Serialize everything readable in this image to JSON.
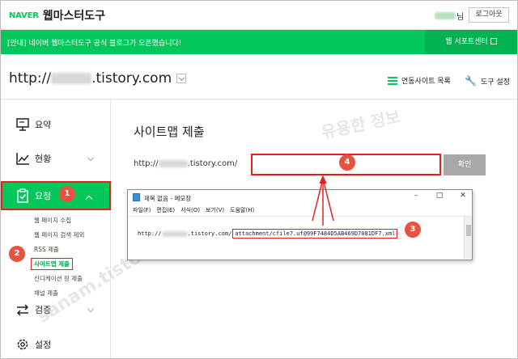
{
  "header": {
    "logo_naver": "NAVER",
    "logo_title": "웹마스터도구",
    "user_suffix": "님",
    "logout_label": "로그아웃"
  },
  "banner": {
    "text": "[안내] 네이버 웹마스터도구 공식 블로그가 오픈했습니다!",
    "support_label": "웹 서포트센터"
  },
  "site": {
    "url_prefix": "http://",
    "url_suffix": ".tistory.com",
    "linked_sites_label": "연동사이트 목록",
    "tool_settings_label": "도구 설정"
  },
  "sidebar": {
    "summary": "요약",
    "status": "현황",
    "request": "요청",
    "sub_items": [
      "웹 페이지 수집",
      "웹 페이지 검색 제외",
      "RSS 제출",
      "사이트맵 제출",
      "신디케이션 핑 제출",
      "채널 제출"
    ],
    "verify": "검증",
    "settings": "설정"
  },
  "main": {
    "title": "사이트맵 제출",
    "prefix_start": "http://",
    "prefix_end": ".tistory.com/",
    "input_value": "",
    "confirm_label": "확인"
  },
  "notepad": {
    "title": "제목 없음 - 메모장",
    "menu": [
      "파일(F)",
      "편집(E)",
      "서식(O)",
      "보기(V)",
      "도움말(H)"
    ],
    "line_start": "http://",
    "line_mid": ".tistory.com/",
    "line_highlight": "attachment/cfile7.uf@99F7484D5AB469D7081DF7.xml"
  },
  "badges": [
    "1",
    "2",
    "3",
    "4"
  ],
  "colors": {
    "brand_green": "#03c75a",
    "highlight_red": "#e52020",
    "badge_orange": "#e8533f"
  }
}
